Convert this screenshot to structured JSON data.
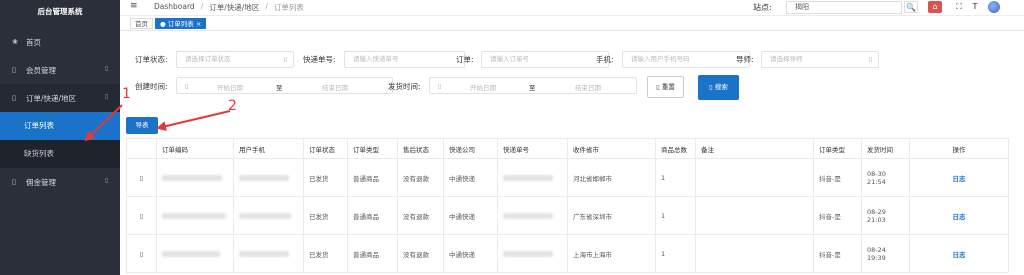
{
  "app": {
    "title": "后台管理系统"
  },
  "sidebar": {
    "items": [
      {
        "label": "首页",
        "icon": "dashboard-icon",
        "glyph": "❀"
      },
      {
        "label": "会员管理",
        "icon": "users-icon",
        "glyph": "▯"
      },
      {
        "label": "订单/快递/地区",
        "icon": "order-icon",
        "glyph": "▯"
      },
      {
        "label": "佣金管理",
        "icon": "commission-icon",
        "glyph": "▯"
      }
    ],
    "submenu": [
      {
        "label": "订单列表",
        "active": true
      },
      {
        "label": "缺货列表",
        "active": false
      }
    ],
    "caret": "▯"
  },
  "header": {
    "breadcrumbs": [
      "Dashboard",
      "订单/快递/地区",
      "订单列表"
    ],
    "separator": "/",
    "site_label": "站点:",
    "site_value": "揭阳",
    "menu_glyph": "≡",
    "search_glyph": "🔍",
    "home_glyph": "⌂",
    "fullscreen_glyph": "⛶",
    "font_glyph": "T"
  },
  "tags": {
    "home": "首页",
    "active": "订单列表",
    "close": "×"
  },
  "filters": {
    "order_status": {
      "label": "订单状态:",
      "placeholder": "请选择订单状态"
    },
    "tracking_no": {
      "label": "快递单号:",
      "placeholder": "请输入快递单号"
    },
    "order_no": {
      "label": "订单:",
      "placeholder": "请输入订单号"
    },
    "phone": {
      "label": "手机:",
      "placeholder": "请输入用户手机号码"
    },
    "mentor": {
      "label": "导师:",
      "placeholder": "请选择导师"
    },
    "created_time": {
      "label": "创建时间:",
      "start": "开始日期",
      "to": "至",
      "end": "结束日期"
    },
    "ship_time": {
      "label": "发货时间:",
      "start": "开始日期",
      "to": "至",
      "end": "结束日期"
    },
    "dropdown_glyph": "▯",
    "date_glyph": "▯"
  },
  "buttons": {
    "reset": "▯ 重置",
    "search": "▯ 搜索",
    "export": "导表"
  },
  "table": {
    "headers": [
      "",
      "订单编码",
      "用户手机",
      "订单状态",
      "订单类型",
      "售后状态",
      "快递公司",
      "快递单号",
      "收件省市",
      "商品总数",
      "备注",
      "订单类型",
      "发货时间",
      "操作"
    ],
    "checkbox_glyph": "▯",
    "rows": [
      {
        "status": "已发货",
        "type": "普通商品",
        "after_sale": "没有退款",
        "courier": "中通快递",
        "city": "河北省邯郸市",
        "qty": "1",
        "remark": "",
        "order_type": "抖音-是",
        "ship_time": "08-30 21:54",
        "action": "日志"
      },
      {
        "status": "已发货",
        "type": "普通商品",
        "after_sale": "没有退款",
        "courier": "中通快递",
        "city": "广东省深圳市",
        "qty": "1",
        "remark": "",
        "order_type": "抖音-是",
        "ship_time": "08-29 21:03",
        "action": "日志"
      },
      {
        "status": "已发货",
        "type": "普通商品",
        "after_sale": "没有退款",
        "courier": "中通快递",
        "city": "上海市上海市",
        "qty": "1",
        "remark": "",
        "order_type": "抖音-是",
        "ship_time": "08-24 19:39",
        "action": "日志"
      }
    ]
  },
  "annotations": {
    "first": "1",
    "second": "2",
    "color": "#e53935"
  }
}
